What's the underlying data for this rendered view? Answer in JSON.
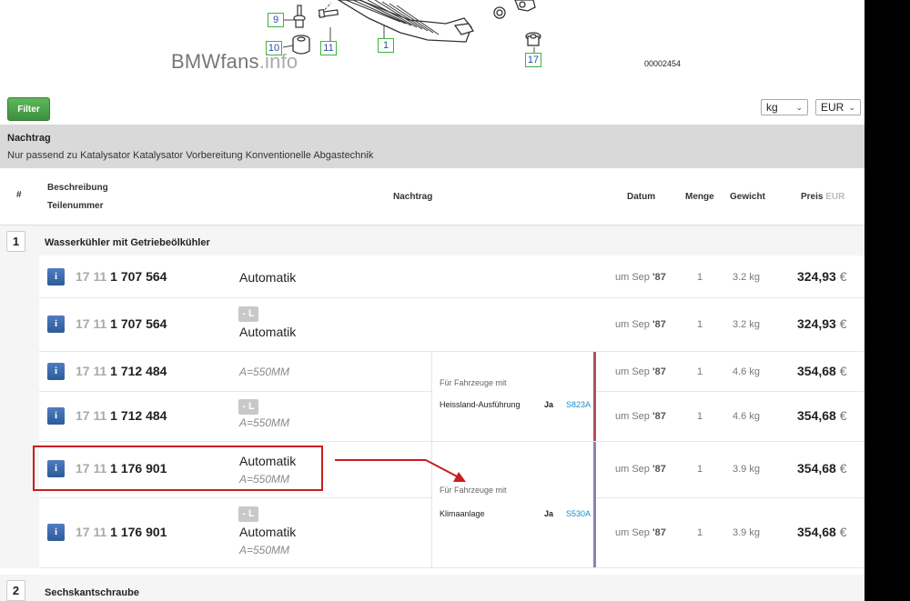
{
  "diagram": {
    "watermark_main": "BMWfans",
    "watermark_suffix": ".info",
    "code": "00002454",
    "callouts": [
      "9",
      "10",
      "11",
      "1",
      "17"
    ],
    "accent": "#3cb43c"
  },
  "toolbar": {
    "filter_label": "Filter",
    "unit_value": "kg",
    "currency_value": "EUR",
    "chevron_icon": "chevron-down-icon"
  },
  "note": {
    "title": "Nachtrag",
    "text": "Nur passend zu Katalysator Katalysator Vorbereitung Konventionelle Abgastechnik"
  },
  "table_header": {
    "num": "#",
    "beschreibung": "Beschreibung",
    "teilenummer": "Teilenummer",
    "nachtrag": "Nachtrag",
    "datum": "Datum",
    "menge": "Menge",
    "gewicht": "Gewicht",
    "preis": "Preis",
    "preis_currency": "EUR"
  },
  "groups": [
    {
      "number": "1",
      "title": "Wasserkühler mit Getriebeölkühler",
      "rows": [
        {
          "info": "i",
          "part_prefix": "17 11",
          "part_number": "1 707 564",
          "badge": "",
          "desc": "Automatik",
          "spec": "",
          "date_prefix": "um Sep",
          "date_year": "'87",
          "qty": "1",
          "weight": "3.2 kg",
          "price": "324,93",
          "currency": "€"
        },
        {
          "info": "i",
          "part_prefix": "17 11",
          "part_number": "1 707 564",
          "badge": "- L",
          "desc": "Automatik",
          "spec": "",
          "date_prefix": "um Sep",
          "date_year": "'87",
          "qty": "1",
          "weight": "3.2 kg",
          "price": "324,93",
          "currency": "€"
        },
        {
          "info": "i",
          "part_prefix": "17 11",
          "part_number": "1 712 484",
          "badge": "",
          "desc": "",
          "spec": "A=550MM",
          "date_prefix": "um Sep",
          "date_year": "'87",
          "qty": "1",
          "weight": "4.6 kg",
          "price": "354,68",
          "currency": "€"
        },
        {
          "info": "i",
          "part_prefix": "17 11",
          "part_number": "1 712 484",
          "badge": "- L",
          "desc": "",
          "spec": "A=550MM",
          "date_prefix": "um Sep",
          "date_year": "'87",
          "qty": "1",
          "weight": "4.6 kg",
          "price": "354,68",
          "currency": "€"
        },
        {
          "info": "i",
          "part_prefix": "17 11",
          "part_number": "1 176 901",
          "badge": "",
          "desc": "Automatik",
          "spec": "A=550MM",
          "date_prefix": "um Sep",
          "date_year": "'87",
          "qty": "1",
          "weight": "3.9 kg",
          "price": "354,68",
          "currency": "€"
        },
        {
          "info": "i",
          "part_prefix": "17 11",
          "part_number": "1 176 901",
          "badge": "- L",
          "desc": "Automatik",
          "spec": "A=550MM",
          "date_prefix": "um Sep",
          "date_year": "'87",
          "qty": "1",
          "weight": "3.9 kg",
          "price": "354,68",
          "currency": "€"
        }
      ],
      "conditions": [
        {
          "caption": "Für Fahrzeuge mit",
          "name": "Heissland-Ausführung",
          "ja": "Ja",
          "code": "S823A",
          "bar_color": "#b4505a"
        },
        {
          "caption": "Für Fahrzeuge mit",
          "name": "Klimaanlage",
          "ja": "Ja",
          "code": "S530A",
          "bar_color": "#8c82b4"
        }
      ]
    },
    {
      "number": "2",
      "title": "Sechskantschraube"
    }
  ],
  "annotation_color": "#c81e1e"
}
